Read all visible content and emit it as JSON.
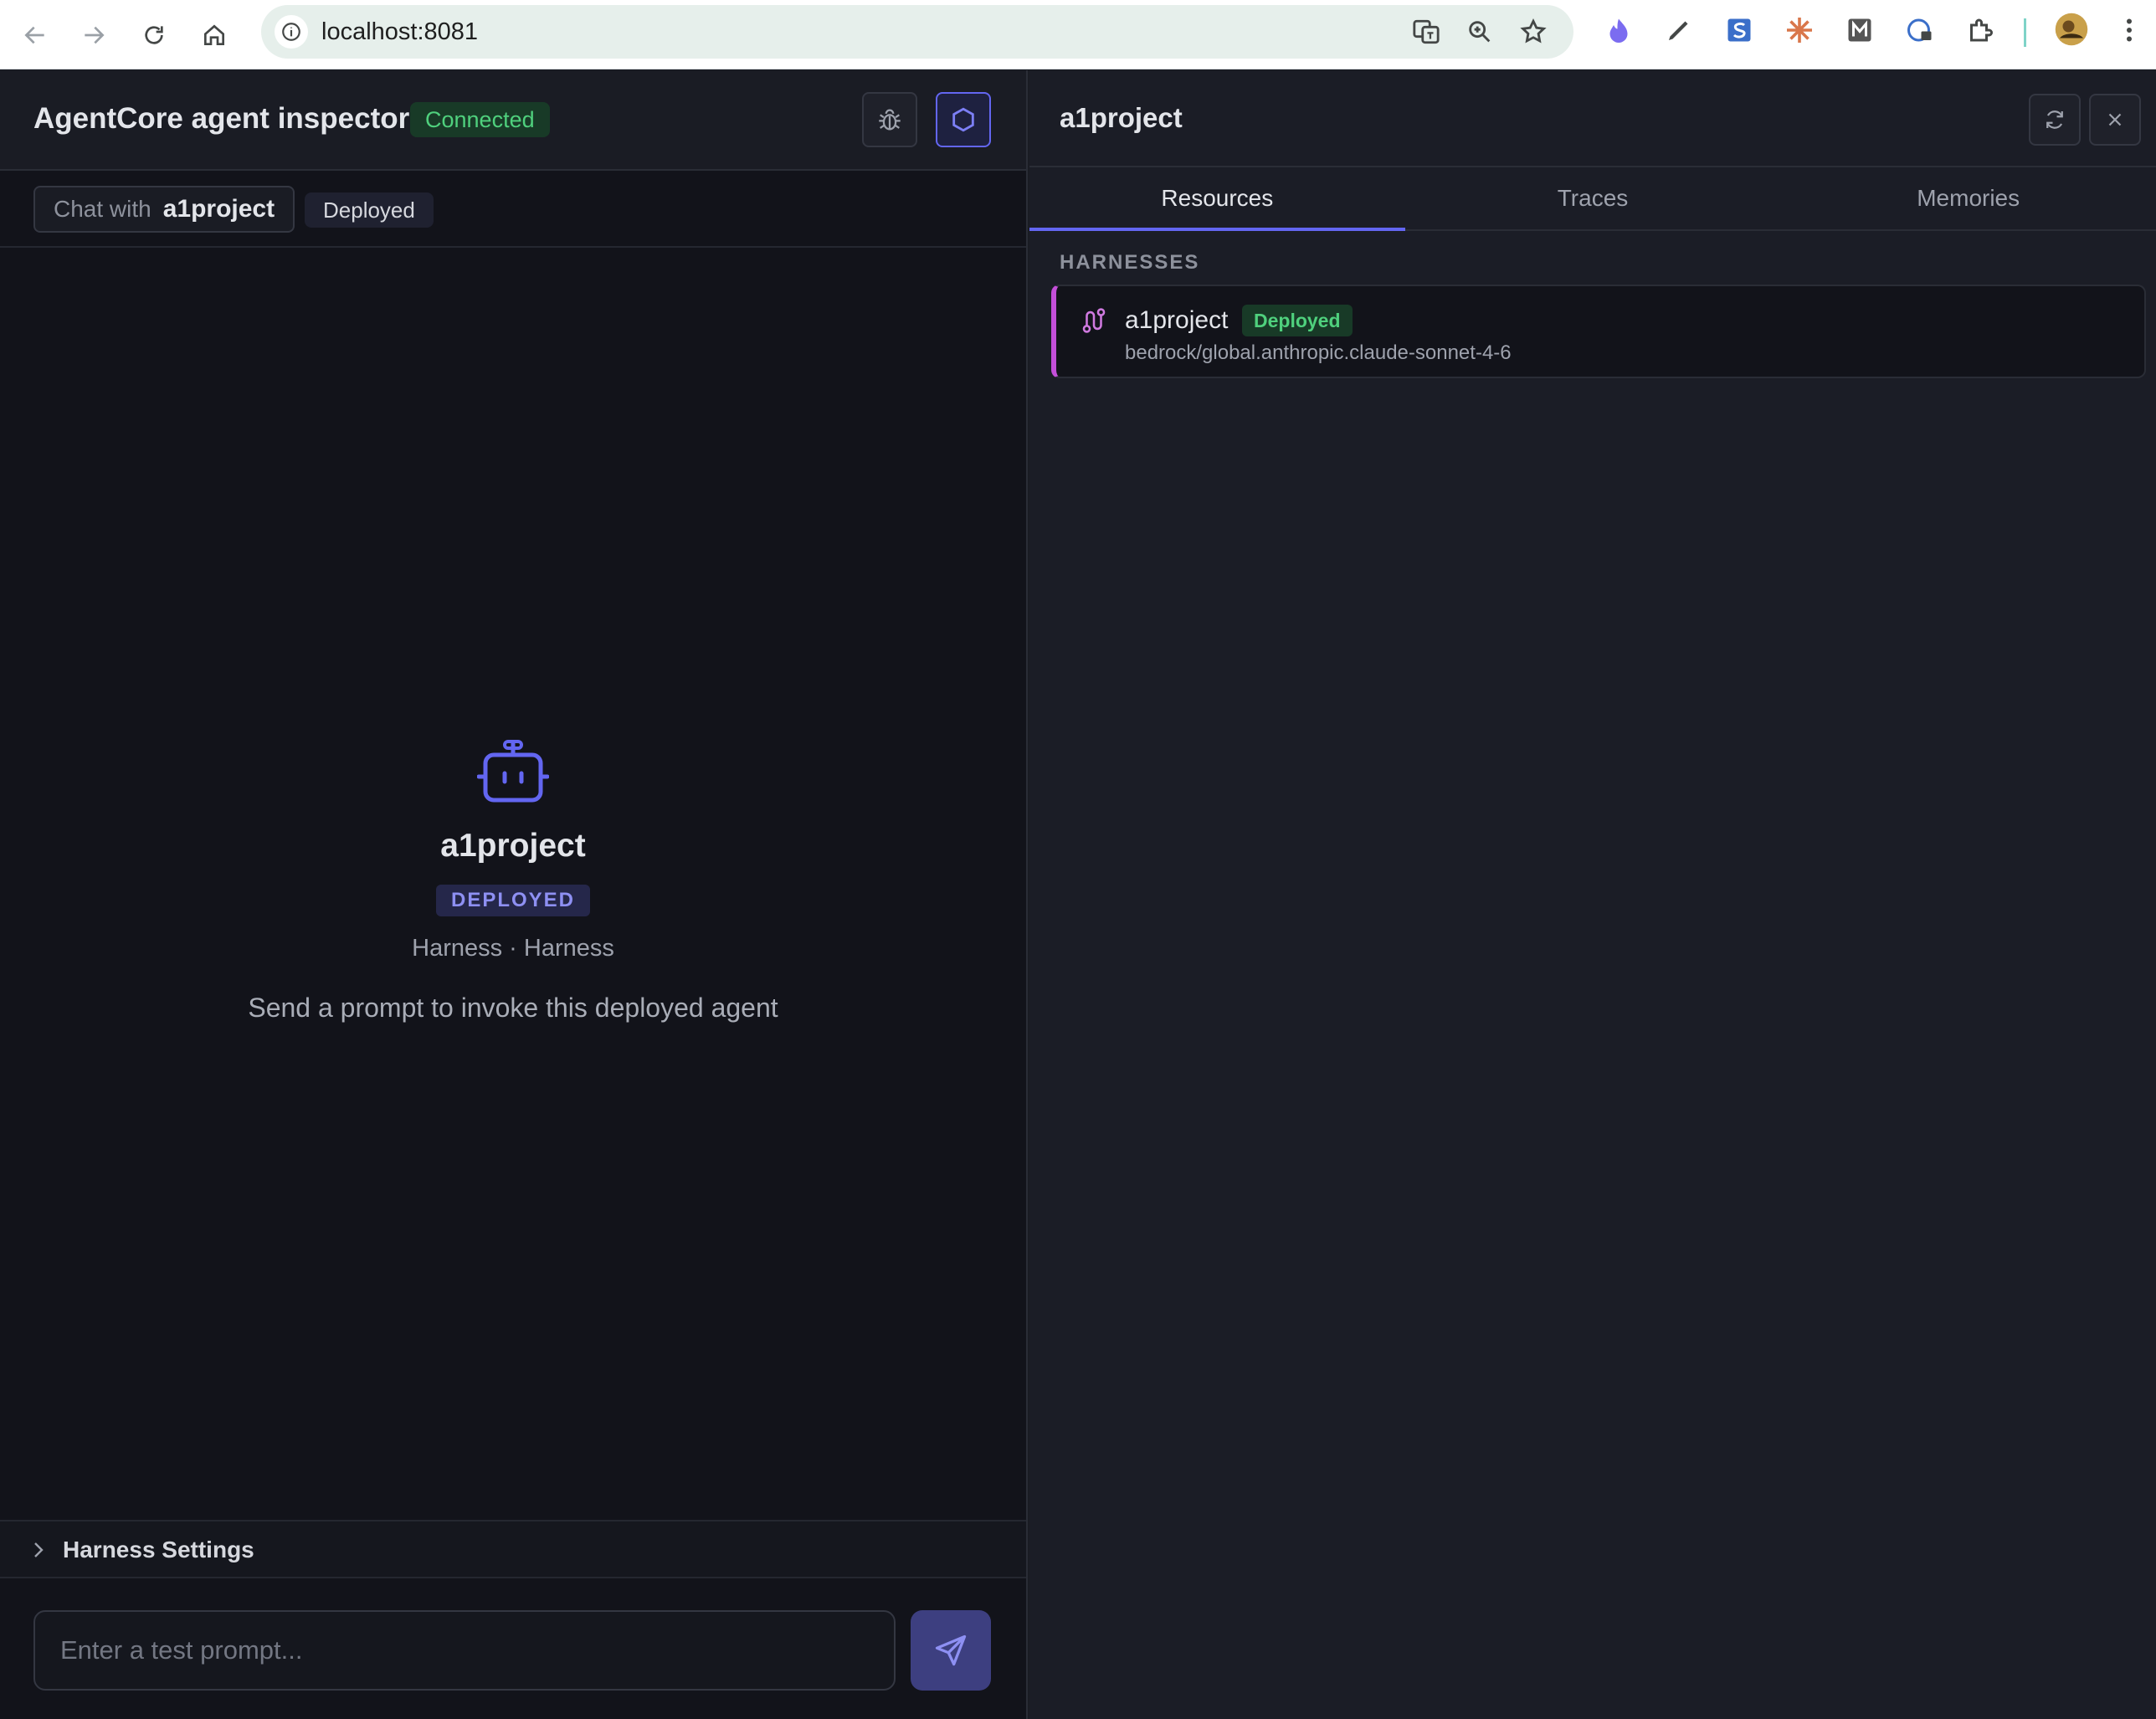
{
  "browser": {
    "url": "localhost:8081"
  },
  "left": {
    "title": "AgentCore agent inspector",
    "status": "Connected",
    "chat_label": "Chat with",
    "chat_agent": "a1project",
    "deployed_pill": "Deployed",
    "empty_state": {
      "agent_name": "a1project",
      "tag": "DEPLOYED",
      "meta": "Harness · Harness",
      "hint": "Send a prompt to invoke this deployed agent"
    },
    "settings_label": "Harness Settings",
    "prompt_placeholder": "Enter a test prompt..."
  },
  "right": {
    "title": "a1project",
    "tabs": [
      {
        "label": "Resources",
        "active": true
      },
      {
        "label": "Traces",
        "active": false
      },
      {
        "label": "Memories",
        "active": false
      }
    ],
    "section_label": "HARNESSES",
    "harnesses": [
      {
        "name": "a1project",
        "badge": "Deployed",
        "model": "bedrock/global.anthropic.claude-sonnet-4-6"
      }
    ]
  },
  "colors": {
    "accent": "#6366f1",
    "success": "#4fd07d",
    "harness_border": "#c44fd9"
  }
}
